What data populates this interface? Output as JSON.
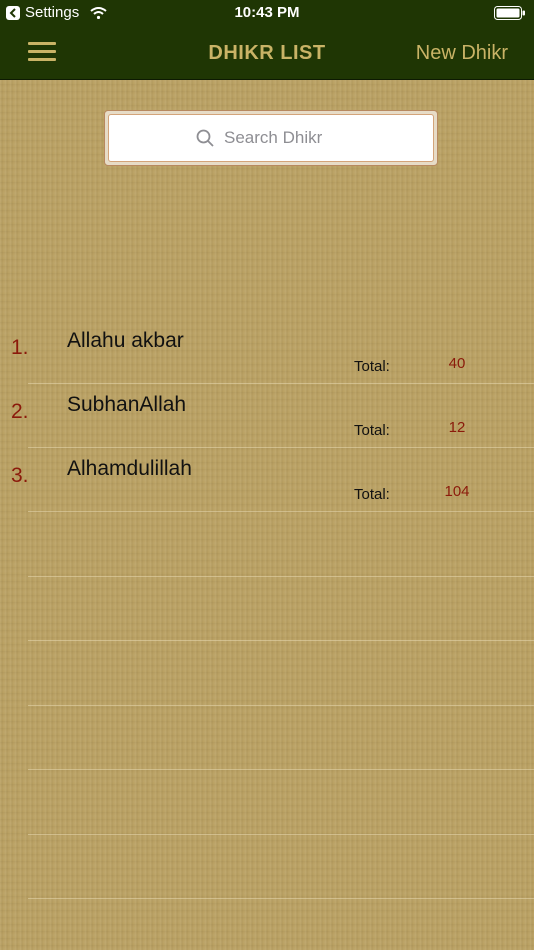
{
  "status": {
    "carrier_back_label": "Settings",
    "time": "10:43 PM"
  },
  "navbar": {
    "title": "DHIKR LIST",
    "new_label": "New Dhikr",
    "bg_color": "#1f3604",
    "accent_color": "#c9b366"
  },
  "search": {
    "placeholder": "Search Dhikr"
  },
  "list": {
    "items": [
      {
        "index": "1.",
        "name": "Allahu akbar",
        "total_label": "Total:",
        "total_value": "40"
      },
      {
        "index": "2.",
        "name": "SubhanAllah",
        "total_label": "Total:",
        "total_value": "12"
      },
      {
        "index": "3.",
        "name": "Alhamdulillah",
        "total_label": "Total:",
        "total_value": "104"
      }
    ],
    "index_color": "#8b1a0b"
  }
}
